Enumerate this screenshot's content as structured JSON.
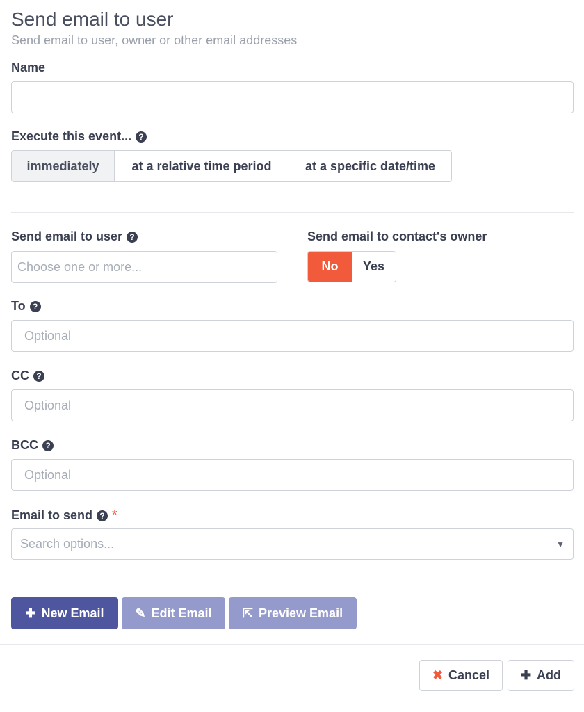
{
  "header": {
    "title": "Send email to user",
    "subtitle": "Send email to user, owner or other email addresses"
  },
  "fields": {
    "name_label": "Name",
    "name_value": "",
    "execute_label": "Execute this event...",
    "execute_options": [
      "immediately",
      "at a relative time period",
      "at a specific date/time"
    ],
    "execute_selected": "immediately",
    "send_user_label": "Send email to user",
    "send_user_placeholder": "Choose one or more...",
    "owner_label": "Send email to contact's owner",
    "owner_options": [
      "No",
      "Yes"
    ],
    "owner_selected": "No",
    "to_label": "To",
    "to_placeholder": "Optional",
    "cc_label": "CC",
    "cc_placeholder": "Optional",
    "bcc_label": "BCC",
    "bcc_placeholder": "Optional",
    "email_label": "Email to send",
    "email_required_mark": "*",
    "email_placeholder": "Search options..."
  },
  "actions": {
    "new_email": "New Email",
    "edit_email": "Edit Email",
    "preview_email": "Preview Email",
    "cancel": "Cancel",
    "add": "Add"
  },
  "icons": {
    "help": "question-circle-icon",
    "plus": "plus-icon",
    "edit": "edit-icon",
    "external": "external-link-icon",
    "close": "close-icon",
    "caret": "caret-down-icon"
  },
  "colors": {
    "accent": "#f15a3b",
    "primary": "#4e56a0",
    "muted": "#949acb"
  }
}
